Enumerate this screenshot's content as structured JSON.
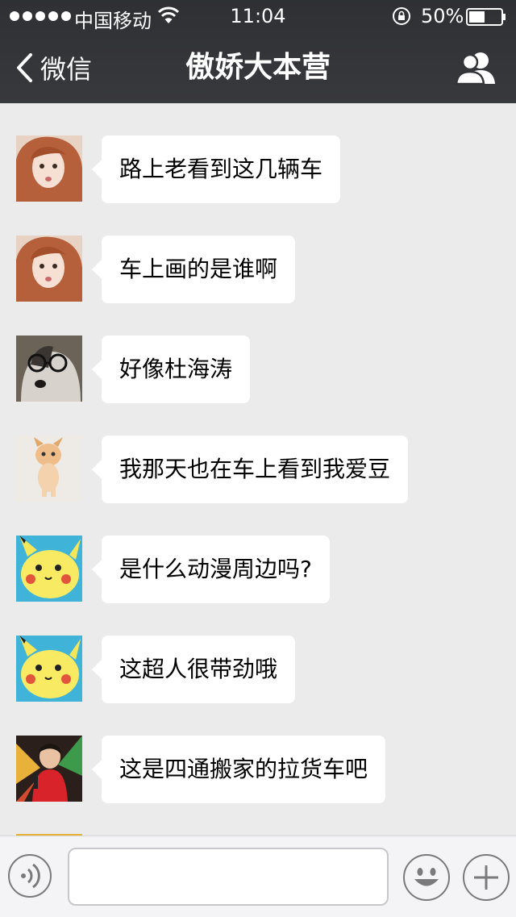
{
  "status_bar": {
    "carrier": "中国移动",
    "time": "11:04",
    "battery": "50%"
  },
  "nav": {
    "back_label": "微信",
    "title": "傲娇大本营"
  },
  "messages": [
    {
      "avatar": "avatar-red-hair-girl",
      "text": "路上老看到这几辆车"
    },
    {
      "avatar": "avatar-red-hair-girl",
      "text": "车上画的是谁啊"
    },
    {
      "avatar": "avatar-husky-glasses",
      "text": "好像杜海涛"
    },
    {
      "avatar": "avatar-kitten",
      "text": "我那天也在车上看到我爱豆"
    },
    {
      "avatar": "avatar-pikachu",
      "text": "是什么动漫周边吗?"
    },
    {
      "avatar": "avatar-pikachu",
      "text": "这超人很带劲哦"
    },
    {
      "avatar": "avatar-singer-red",
      "text": "这是四通搬家的拉货车吧"
    }
  ],
  "input_bar": {
    "value": "",
    "placeholder": ""
  },
  "colors": {
    "header_bg": "#2f3034",
    "chat_bg": "#ebebeb",
    "bubble_bg": "#ffffff"
  }
}
